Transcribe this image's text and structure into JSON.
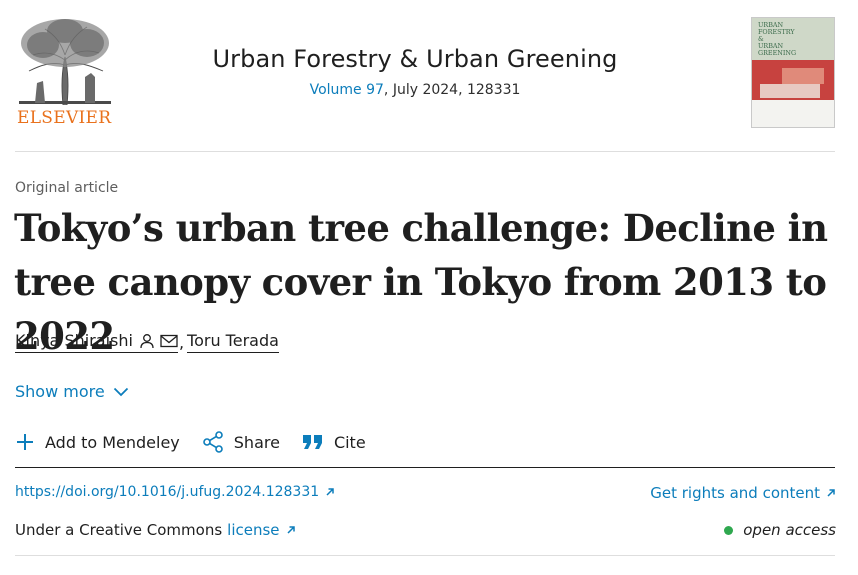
{
  "publisher": {
    "name": "ELSEVIER"
  },
  "journal": {
    "title": "Urban Forestry & Urban Greening",
    "volume_link": "Volume 97",
    "issue_info": ", July 2024, 128331",
    "cover_title_lines": [
      "URBAN",
      "FORESTRY",
      "&",
      "URBAN",
      "GREENING"
    ]
  },
  "article": {
    "type": "Original article",
    "title": "Tokyo’s urban tree challenge: Decline in tree canopy cover in Tokyo from 2013 to 2022"
  },
  "authors": [
    {
      "name": "Kinya Shiraishi",
      "icons": [
        "person-icon",
        "envelope-icon"
      ]
    },
    {
      "name": "Toru Terada"
    }
  ],
  "authors_separator": ",",
  "show_more_label": "Show more",
  "toolbar": {
    "mendeley_label": "Add to Mendeley",
    "share_label": "Share",
    "cite_label": "Cite"
  },
  "links": {
    "doi": "https://doi.org/10.1016/j.ufug.2024.128331",
    "rights": "Get rights and content"
  },
  "license": {
    "prefix": "Under a Creative Commons",
    "link_label": "license"
  },
  "access": {
    "label": "open access"
  },
  "colors": {
    "link": "#0c7dbb",
    "brand": "#e9711c",
    "open_access": "#2fa84f"
  }
}
